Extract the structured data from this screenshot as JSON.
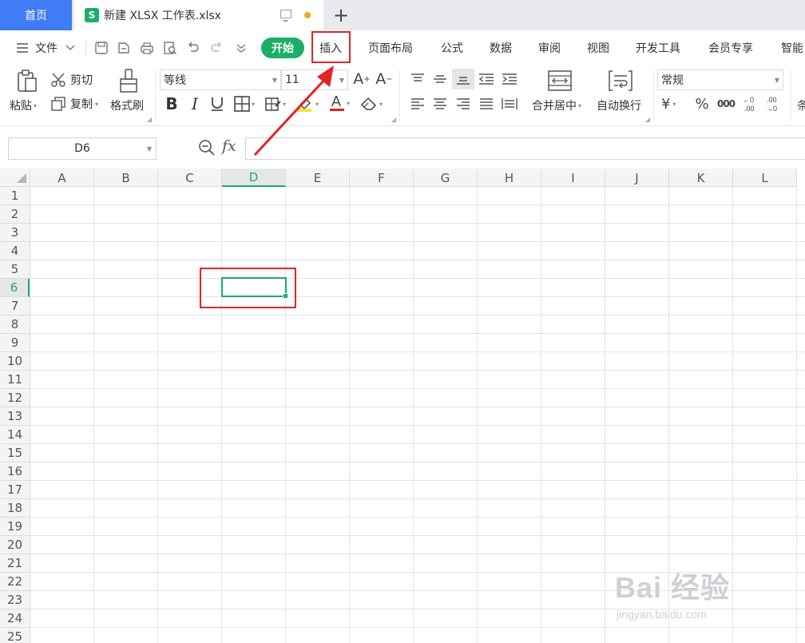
{
  "tabs": {
    "home": "首页",
    "doc_icon": "S",
    "doc_title": "新建 XLSX 工作表.xlsx",
    "new_tab": "+"
  },
  "menu": {
    "file": "文件",
    "start": "开始",
    "items": [
      "插入",
      "页面布局",
      "公式",
      "数据",
      "审阅",
      "视图",
      "开发工具",
      "会员专享",
      "智能"
    ]
  },
  "ribbon": {
    "paste": "粘贴",
    "cut": "剪切",
    "copy": "复制",
    "format_painter": "格式刷",
    "font_name": "等线",
    "font_size": "11",
    "merge_center": "合并居中",
    "wrap_text": "自动换行",
    "number_format": "常规",
    "currency": "¥",
    "percent": "%",
    "thousands": "000",
    "partial_next": "条"
  },
  "formula_bar": {
    "name_box": "D6",
    "fx": "fx",
    "content": ""
  },
  "sheet": {
    "columns": [
      "A",
      "B",
      "C",
      "D",
      "E",
      "F",
      "G",
      "H",
      "I",
      "J",
      "K",
      "L"
    ],
    "rows": [
      "1",
      "2",
      "3",
      "4",
      "5",
      "6",
      "7",
      "8",
      "9",
      "10",
      "11",
      "12",
      "13",
      "14",
      "15",
      "16",
      "17",
      "18",
      "19",
      "20",
      "21",
      "22",
      "23",
      "24",
      "25"
    ],
    "active_cell": "D6"
  },
  "watermark": {
    "brand": "Bai 经验",
    "url": "jingyan.baidu.com"
  },
  "colors": {
    "accent": "#1aae66",
    "home_tab": "#3f7cf5",
    "annotation": "#e2232a"
  }
}
